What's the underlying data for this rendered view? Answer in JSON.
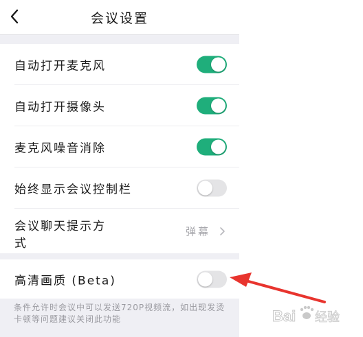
{
  "header": {
    "title": "会议设置",
    "back_icon": "chevron-left-icon"
  },
  "settings": [
    {
      "label": "自动打开麦克风",
      "enabled": true
    },
    {
      "label": "自动打开摄像头",
      "enabled": true
    },
    {
      "label": "麦克风噪音消除",
      "enabled": true
    },
    {
      "label": "始终显示会议控制栏",
      "enabled": false
    }
  ],
  "chat_hint": {
    "label": "会议聊天提示方式",
    "value": "弹幕",
    "icon": "chevron-right-icon"
  },
  "hd": {
    "label": "高清画质 (Beta)",
    "enabled": false
  },
  "note": "条件允许时会议中可以发送720P视频流，如出现发烫卡顿等问题建议关闭此功能",
  "watermark": {
    "logo_text": "Bai",
    "paw_icon": "paw-icon",
    "sub_text": "经验"
  },
  "colors": {
    "accent": "#1fae7b",
    "toggle_off": "#e4e4e6",
    "arrow": "#e8342e"
  }
}
